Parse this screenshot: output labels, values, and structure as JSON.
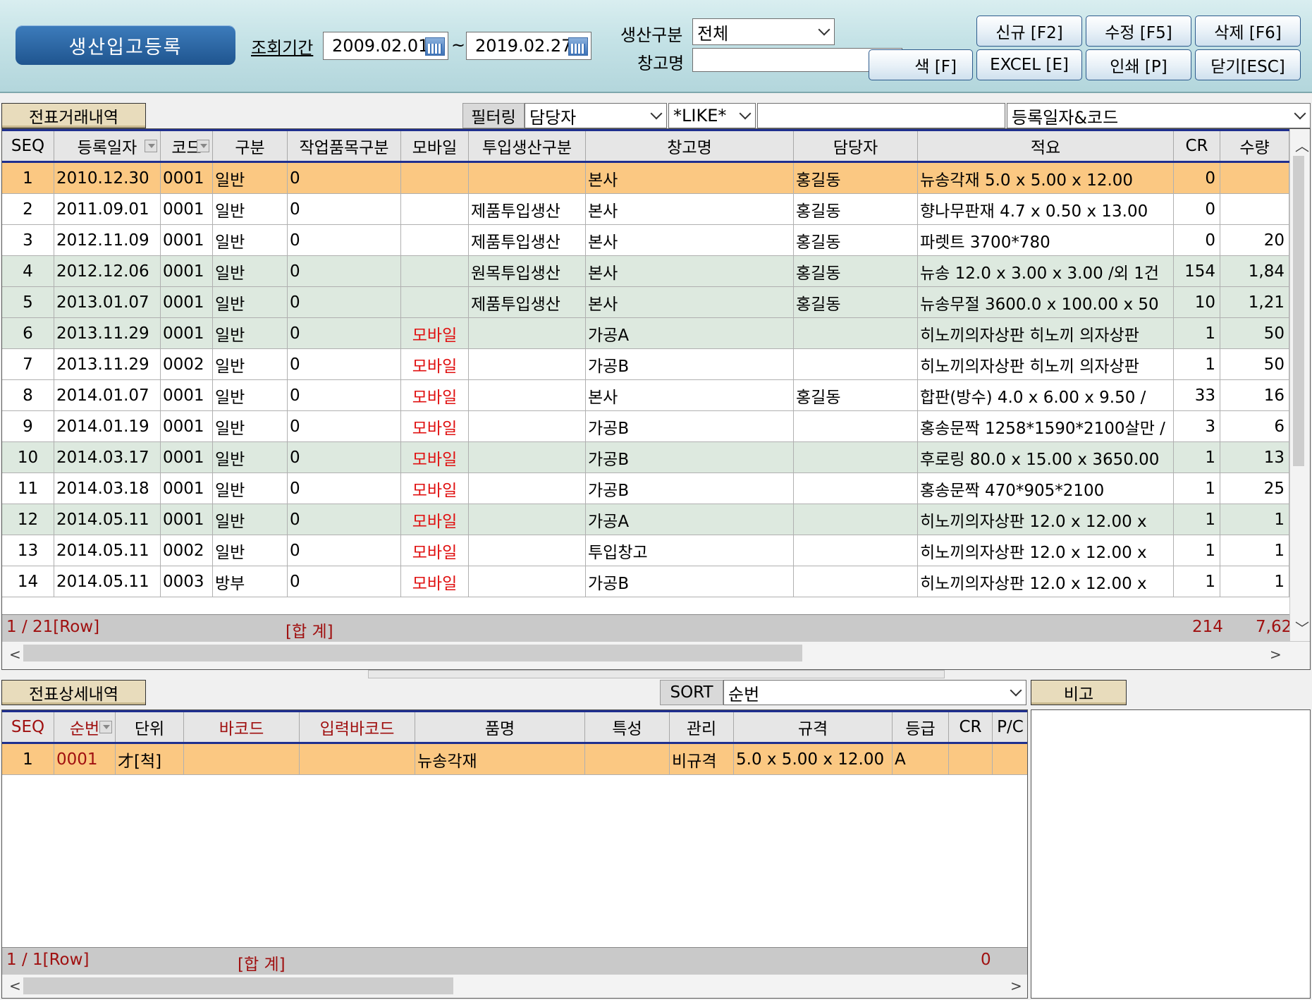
{
  "header": {
    "title": "생산입고등록",
    "period_label": "조회기간",
    "date_from": "2009.02.01",
    "date_sep": "~",
    "date_to": "2019.02.27",
    "prod_type_label": "생산구분",
    "prod_type_value": "전체",
    "warehouse_label": "창고명",
    "warehouse_value": "",
    "buttons": {
      "new": "신규 [F2]",
      "edit": "수정 [F5]",
      "delete": "삭제 [F6]",
      "search": "색 [F]",
      "excel": "EXCEL [E]",
      "print": "인쇄 [P]",
      "close": "닫기[ESC]"
    }
  },
  "upper": {
    "tab_label": "전표거래내역",
    "filter_label": "필터링",
    "filter_field": "담당자",
    "filter_op": "*LIKE*",
    "filter_value": "",
    "sort_field": "등록일자&코드",
    "columns": [
      "SEQ",
      "등록일자",
      "코드",
      "구분",
      "작업품목구분",
      "모바일",
      "투입생산구분",
      "창고명",
      "담당자",
      "적요",
      "CR",
      "수량"
    ],
    "rows": [
      [
        "1",
        "2010.12.30",
        "0001",
        "일반",
        "0",
        "",
        "",
        "본사",
        "홍길동",
        "뉴송각재  5.0 x 5.00 x 12.00",
        "0",
        ""
      ],
      [
        "2",
        "2011.09.01",
        "0001",
        "일반",
        "0",
        "",
        "제품투입생산",
        "본사",
        "홍길동",
        "향나무판재 4.7 x 0.50 x 13.00",
        "0",
        ""
      ],
      [
        "3",
        "2012.11.09",
        "0001",
        "일반",
        "0",
        "",
        "제품투입생산",
        "본사",
        "홍길동",
        "파렛트 3700*780",
        "0",
        "20"
      ],
      [
        "4",
        "2012.12.06",
        "0001",
        "일반",
        "0",
        "",
        "원목투입생산",
        "본사",
        "홍길동",
        "뉴송 12.0 x 3.00 x 3.00 /외 1건",
        "154",
        "1,84"
      ],
      [
        "5",
        "2013.01.07",
        "0001",
        "일반",
        "0",
        "",
        "제품투입생산",
        "본사",
        "홍길동",
        "뉴송무절 3600.0 x 100.00 x 50",
        "10",
        "1,21"
      ],
      [
        "6",
        "2013.11.29",
        "0001",
        "일반",
        "0",
        "모바일",
        "",
        "가공A",
        "",
        "히노끼의자상판 히노끼 의자상판",
        "1",
        "50"
      ],
      [
        "7",
        "2013.11.29",
        "0002",
        "일반",
        "0",
        "모바일",
        "",
        "가공B",
        "",
        "히노끼의자상판 히노끼 의자상판",
        "1",
        "50"
      ],
      [
        "8",
        "2014.01.07",
        "0001",
        "일반",
        "0",
        "모바일",
        "",
        "본사",
        "홍길동",
        "합판(방수) 4.0 x 6.00 x 9.50 /",
        "33",
        "16"
      ],
      [
        "9",
        "2014.01.19",
        "0001",
        "일반",
        "0",
        "모바일",
        "",
        "가공B",
        "",
        "홍송문짝 1258*1590*2100살만 /",
        "3",
        "6"
      ],
      [
        "10",
        "2014.03.17",
        "0001",
        "일반",
        "0",
        "모바일",
        "",
        "가공B",
        "",
        "후로링 80.0 x 15.00 x 3650.00",
        "1",
        "13"
      ],
      [
        "11",
        "2014.03.18",
        "0001",
        "일반",
        "0",
        "모바일",
        "",
        "가공B",
        "",
        "홍송문짝 470*905*2100",
        "1",
        "25"
      ],
      [
        "12",
        "2014.05.11",
        "0001",
        "일반",
        "0",
        "모바일",
        "",
        "가공A",
        "",
        "히노끼의자상판 12.0 x 12.00 x",
        "1",
        "1"
      ],
      [
        "13",
        "2014.05.11",
        "0002",
        "일반",
        "0",
        "모바일",
        "",
        "투입창고",
        "",
        "히노끼의자상판 12.0 x 12.00 x",
        "1",
        "1"
      ],
      [
        "14",
        "2014.05.11",
        "0003",
        "방부",
        "0",
        "모바일",
        "",
        "가공B",
        "",
        "히노끼의자상판 12.0 x 12.00 x",
        "1",
        "1"
      ]
    ],
    "row_count": "1 / 21[Row]",
    "sum_label": "[합  계]",
    "sum_cr": "214",
    "sum_qty": "7,62"
  },
  "lower": {
    "tab_label": "전표상세내역",
    "sort_label": "SORT",
    "sort_value": "순번",
    "remark_label": "비고",
    "columns": [
      "SEQ",
      "순번",
      "단위",
      "바코드",
      "입력바코드",
      "품명",
      "특성",
      "관리",
      "규격",
      "등급",
      "CR",
      "P/C"
    ],
    "rows": [
      [
        "1",
        "0001",
        "才[척]",
        "",
        "",
        "뉴송각재",
        "",
        "비규격",
        "5.0 x 5.00 x 12.00",
        "A",
        "",
        ""
      ]
    ],
    "row_count": "1 / 1[Row]",
    "sum_label": "[합  계]",
    "sum_value": "0"
  },
  "colors": {
    "selected_row": "#fbc882",
    "shaded_row": "#dde9df",
    "mobile_text": "#e01010",
    "header_border": "#1f2f8f"
  }
}
